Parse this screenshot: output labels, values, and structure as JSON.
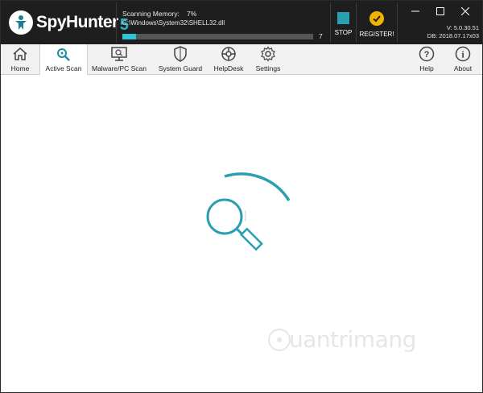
{
  "app": {
    "name": "SpyHunter",
    "version_badge": "5"
  },
  "scan": {
    "label": "Scanning Memory:",
    "percent_text": "7%",
    "percent_value": 0.07,
    "current_path": "C:\\Windows\\System32\\SHELL32.dll",
    "count": "7"
  },
  "header_buttons": {
    "stop_label": "STOP",
    "register_label": "REGISTER!"
  },
  "version_info": {
    "version": "V: 5.0.30.51",
    "db": "DB: 2018.07.17x03"
  },
  "toolbar": {
    "items": [
      {
        "id": "home",
        "label": "Home",
        "icon": "home-icon"
      },
      {
        "id": "active-scan",
        "label": "Active Scan",
        "icon": "magnifier-icon",
        "active": true
      },
      {
        "id": "malware-scan",
        "label": "Malware/PC Scan",
        "icon": "monitor-scan-icon"
      },
      {
        "id": "system-guard",
        "label": "System Guard",
        "icon": "shield-icon"
      },
      {
        "id": "helpdesk",
        "label": "HelpDesk",
        "icon": "lifebuoy-icon"
      },
      {
        "id": "settings",
        "label": "Settings",
        "icon": "gear-icon"
      },
      {
        "id": "help",
        "label": "Help",
        "icon": "question-icon"
      },
      {
        "id": "about",
        "label": "About",
        "icon": "info-icon"
      }
    ]
  },
  "watermark": {
    "text": "uantrimang"
  },
  "colors": {
    "titlebar": "#1e1e1e",
    "accent": "#2a9fb0",
    "progress": "#2ec4d4",
    "register": "#f0b400"
  }
}
